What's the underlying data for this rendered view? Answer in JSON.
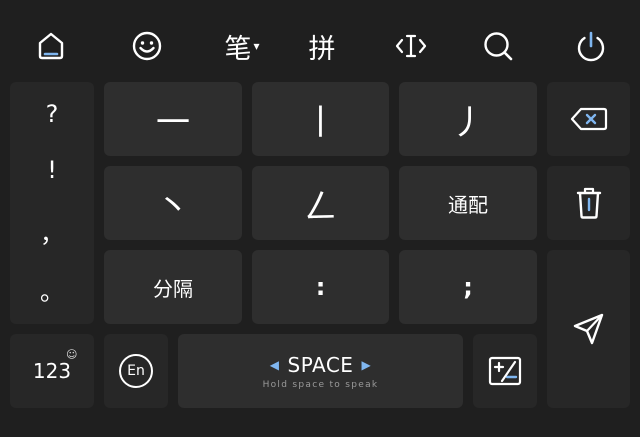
{
  "toolbar": {
    "items": [
      {
        "name": "home-icon"
      },
      {
        "name": "emoji-icon"
      },
      {
        "label": "笔",
        "has_dropdown": true,
        "dropdown_glyph": "▾"
      },
      {
        "label": "拼"
      },
      {
        "name": "text-cursor-icon"
      },
      {
        "name": "search-icon"
      },
      {
        "name": "power-icon"
      }
    ]
  },
  "punctuation_column": [
    "?",
    "!",
    "，",
    "。"
  ],
  "strokes": {
    "horizontal": "一",
    "vertical": "丨",
    "left_falling": "丿",
    "dot": "丶",
    "turning": "ㄥ"
  },
  "keys": {
    "wildcard": "通配",
    "separator": "分隔",
    "colon": ":",
    "semicolon": ";",
    "numbers": "123",
    "numbers_badge": "☺",
    "english": "En",
    "space_label": "SPACE",
    "space_arrow_left": "◀",
    "space_arrow_right": "▶",
    "space_hint": "Hold space to speak"
  },
  "side_keys": [
    {
      "name": "backspace-icon"
    },
    {
      "name": "trash-icon"
    },
    {
      "name": "send-icon"
    }
  ],
  "colors": {
    "background": "#1f1f1f",
    "key": "#2e2e2e",
    "key_dark": "#272727",
    "accent": "#7fb6f0",
    "text": "#ffffff"
  }
}
